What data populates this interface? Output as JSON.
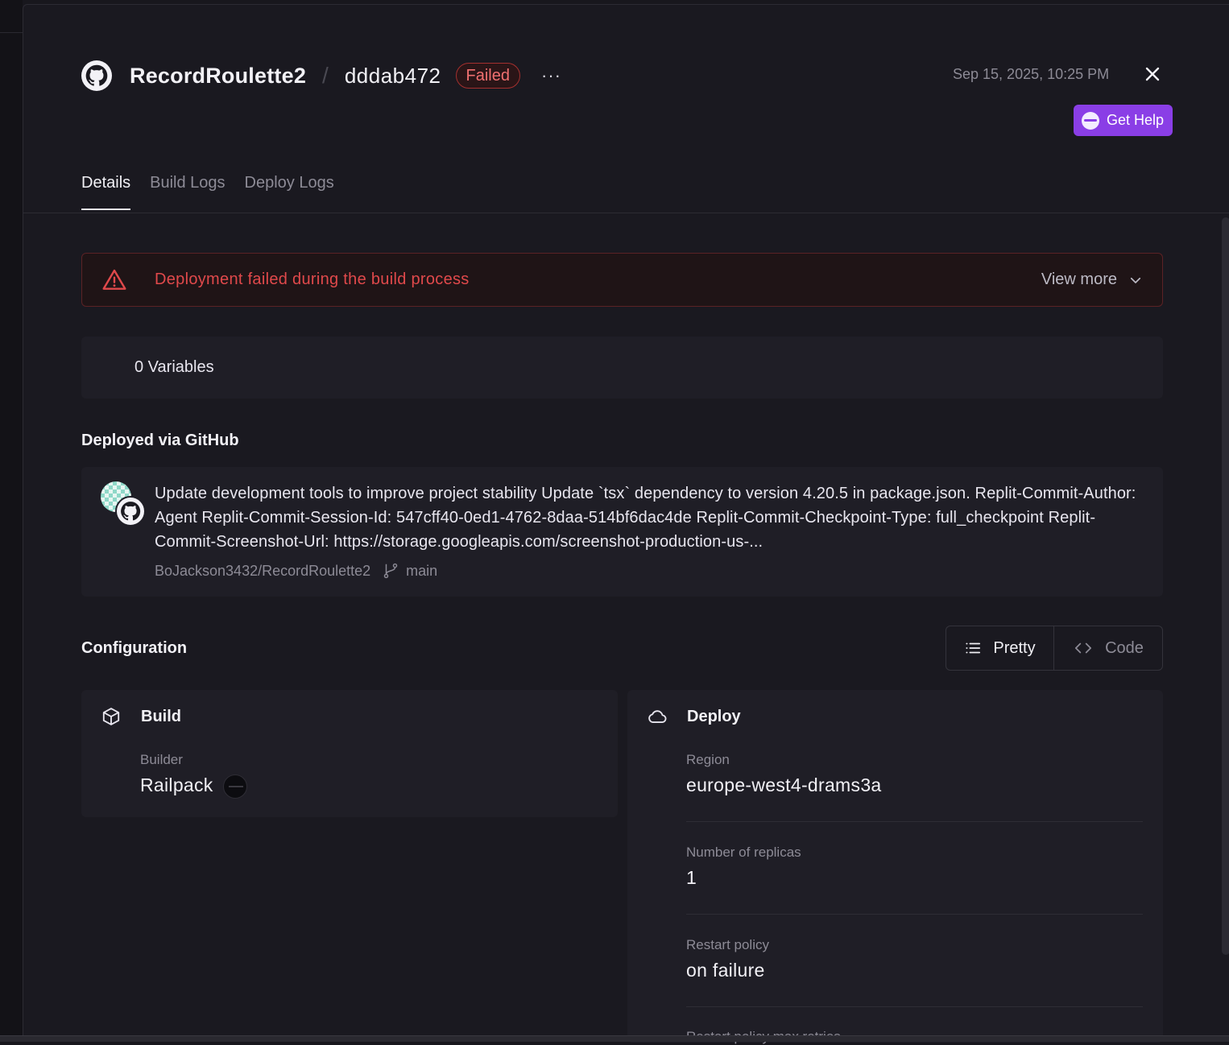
{
  "header": {
    "project_name": "RecordRoulette2",
    "separator": "/",
    "commit_id": "dddab472",
    "status": "Failed",
    "more_label": "···",
    "date": "Sep 15, 2025, 10:25 PM",
    "help_label": "Get Help"
  },
  "tabs": [
    {
      "label": "Details",
      "active": true
    },
    {
      "label": "Build Logs",
      "active": false
    },
    {
      "label": "Deploy Logs",
      "active": false
    }
  ],
  "alert": {
    "message": "Deployment failed during the build process",
    "view_more": "View more"
  },
  "variables": {
    "label": "0 Variables"
  },
  "github": {
    "title": "Deployed via GitHub",
    "commit_message": "Update development tools to improve project stability Update `tsx` dependency to version 4.20.5 in package.json. Replit-Commit-Author: Agent Replit-Commit-Session-Id: 547cff40-0ed1-4762-8daa-514bf6dac4de Replit-Commit-Checkpoint-Type: full_checkpoint Replit-Commit-Screenshot-Url: https://storage.googleapis.com/screenshot-production-us-...",
    "repo": "BoJackson3432/RecordRoulette2",
    "branch": "main"
  },
  "configuration": {
    "title": "Configuration",
    "pretty_label": "Pretty",
    "code_label": "Code",
    "build": {
      "title": "Build",
      "builder_label": "Builder",
      "builder_value": "Railpack"
    },
    "deploy": {
      "title": "Deploy",
      "region_label": "Region",
      "region_value": "europe-west4-drams3a",
      "replicas_label": "Number of replicas",
      "replicas_value": "1",
      "restart_label": "Restart policy",
      "restart_value": "on failure",
      "max_retries_label": "Restart policy max retries"
    }
  },
  "colors": {
    "accent": "#8a3ee6",
    "error": "#e0494b",
    "background": "#1a1920"
  }
}
